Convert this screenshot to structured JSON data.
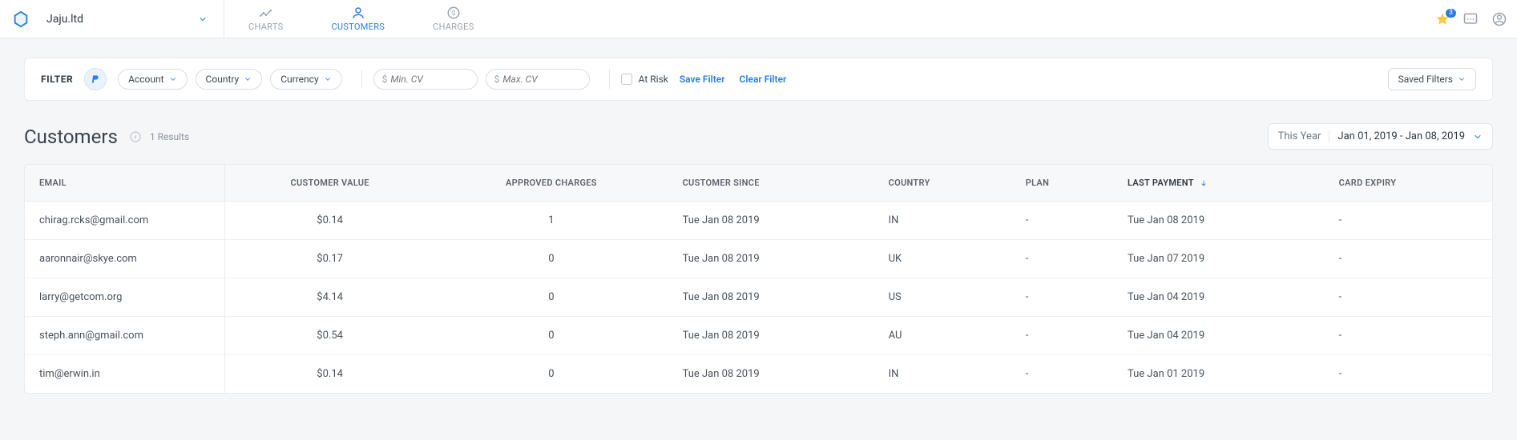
{
  "header": {
    "workspace": "Jaju.ltd",
    "nav": {
      "charts": "CHARTS",
      "customers": "CUSTOMERS",
      "charges": "CHARGES"
    },
    "star_count": "3"
  },
  "filter": {
    "label": "FILTER",
    "account": "Account",
    "country": "Country",
    "currency": "Currency",
    "min_cv_placeholder": "Min. CV",
    "max_cv_placeholder": "Max. CV",
    "at_risk": "At Risk",
    "save_filter": "Save Filter",
    "clear_filter": "Clear Filter",
    "saved_filters": "Saved Filters"
  },
  "page": {
    "title": "Customers",
    "results": "1 Results",
    "date_preset": "This Year",
    "date_range": "Jan 01, 2019 - Jan 08, 2019"
  },
  "table": {
    "headers": {
      "email": "EMAIL",
      "customer_value": "CUSTOMER VALUE",
      "approved_charges": "APPROVED CHARGES",
      "customer_since": "CUSTOMER SINCE",
      "country": "COUNTRY",
      "plan": "PLAN",
      "last_payment": "LAST PAYMENT",
      "card_expiry": "CARD EXPIRY"
    },
    "rows": [
      {
        "email": "chirag.rcks@gmail.com",
        "cv": "$0.14",
        "approved": "1",
        "since": "Tue Jan 08 2019",
        "country": "IN",
        "plan": "-",
        "last_payment": "Tue Jan 08 2019",
        "expiry": "-"
      },
      {
        "email": "aaronnair@skye.com",
        "cv": "$0.17",
        "approved": "0",
        "since": "Tue Jan 08 2019",
        "country": "UK",
        "plan": "-",
        "last_payment": "Tue Jan 07 2019",
        "expiry": "-"
      },
      {
        "email": "larry@getcom.org",
        "cv": "$4.14",
        "approved": "0",
        "since": "Tue Jan 08 2019",
        "country": "US",
        "plan": "-",
        "last_payment": "Tue Jan 04 2019",
        "expiry": "-"
      },
      {
        "email": "steph.ann@gmail.com",
        "cv": "$0.54",
        "approved": "0",
        "since": "Tue Jan 08 2019",
        "country": "AU",
        "plan": "-",
        "last_payment": "Tue Jan 04 2019",
        "expiry": "-"
      },
      {
        "email": "tim@erwin.in",
        "cv": "$0.14",
        "approved": "0",
        "since": "Tue Jan 08 2019",
        "country": "IN",
        "plan": "-",
        "last_payment": "Tue Jan 01 2019",
        "expiry": "-"
      }
    ]
  }
}
